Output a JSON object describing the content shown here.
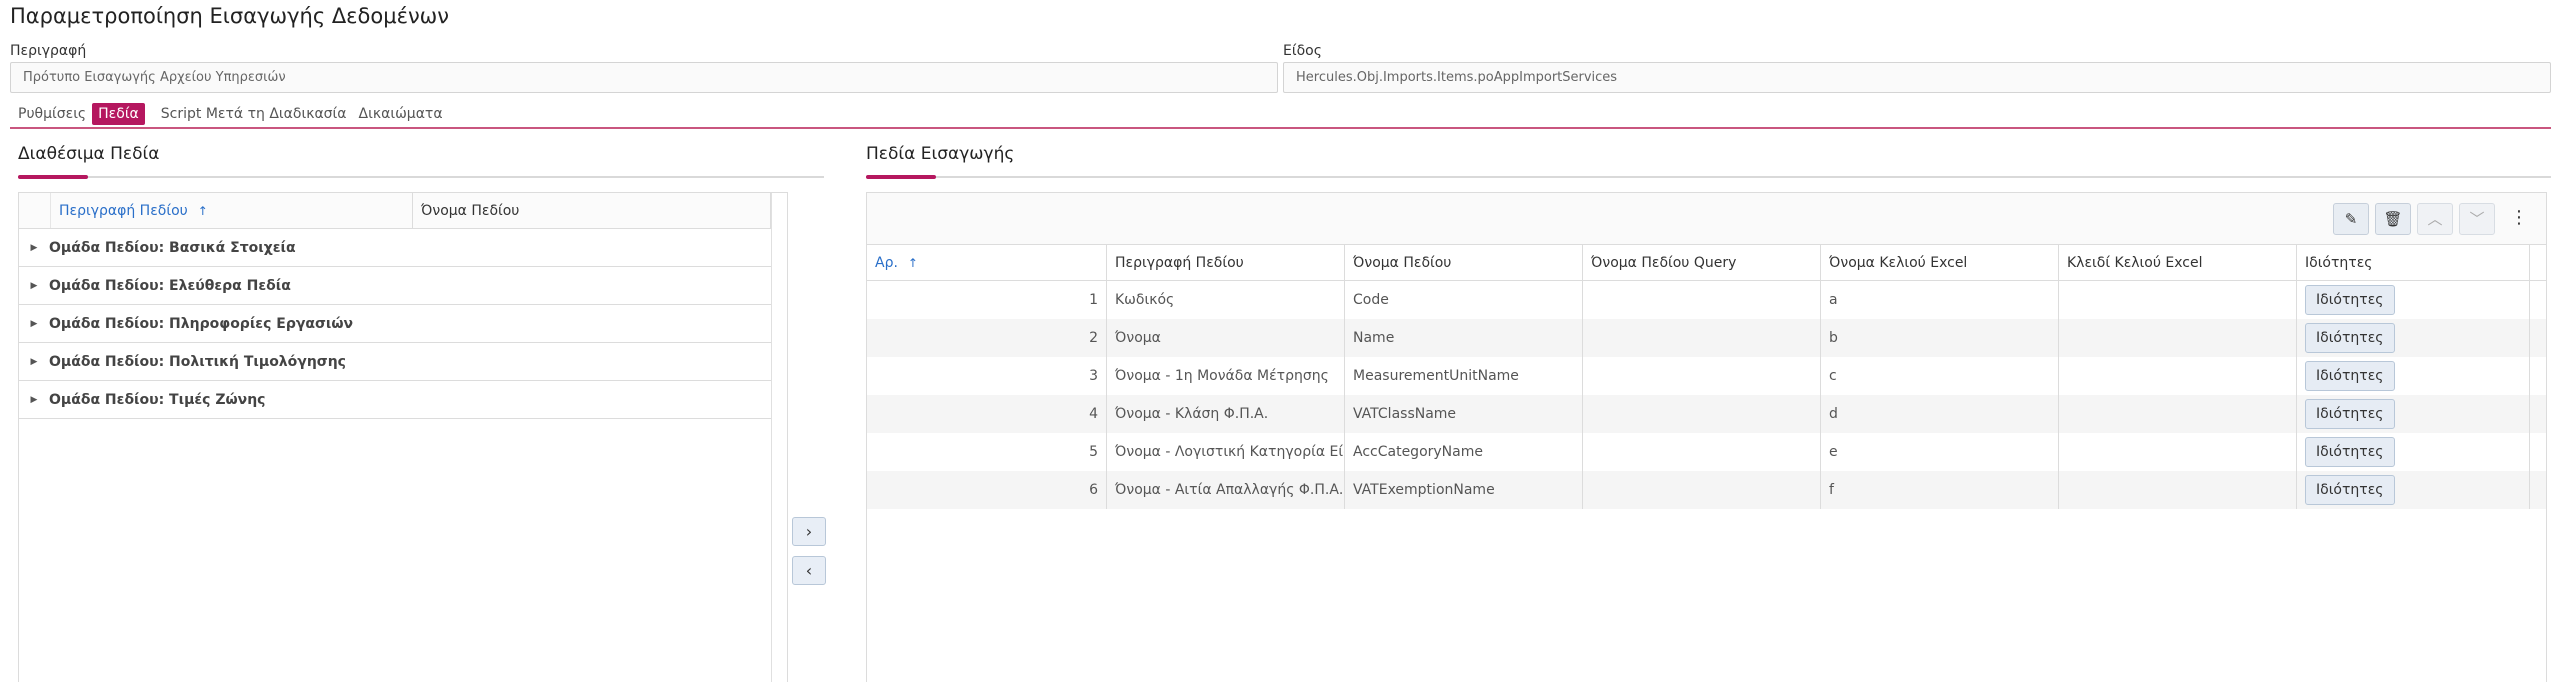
{
  "page": {
    "title": "Παραμετροποίηση Εισαγωγής Δεδομένων"
  },
  "form": {
    "description_label": "Περιγραφή",
    "description_value": "Πρότυπο Εισαγωγής Αρχείου Υπηρεσιών",
    "type_label": "Είδος",
    "type_value": "Hercules.Obj.Imports.Items.poAppImportServices"
  },
  "tabs": [
    {
      "label": "Ρυθμίσεις",
      "active": false
    },
    {
      "label": "Πεδία",
      "active": true
    },
    {
      "label": "Script Μετά τη Διαδικασία",
      "active": false
    },
    {
      "label": "Δικαιώματα",
      "active": false
    }
  ],
  "available": {
    "title": "Διαθέσιμα Πεδία",
    "col_desc": "Περιγραφή Πεδίου",
    "col_name": "Όνομα Πεδίου",
    "sort_icon": "arrow-up-icon",
    "groups": [
      "Ομάδα Πεδίου: Βασικά Στοιχεία",
      "Ομάδα Πεδίου: Ελεύθερα Πεδία",
      "Ομάδα Πεδίου: Πληροφορίες Εργασιών",
      "Ομάδα Πεδίου: Πολιτική Τιμολόγησης",
      "Ομάδα Πεδίου: Τιμές Ζώνης"
    ]
  },
  "move": {
    "right": "›",
    "left": "‹"
  },
  "import": {
    "title": "Πεδία Εισαγωγής",
    "toolbar": {
      "edit": "✎",
      "delete": "🗑",
      "up": "︿",
      "down": "﹀",
      "menu": "⋮"
    },
    "columns": [
      "Αρ.",
      "Περιγραφή Πεδίου",
      "Όνομα Πεδίου",
      "Όνομα Πεδίου Query",
      "Όνομα Κελιού Excel",
      "Κλειδί Κελιού Excel",
      "Ιδιότητες"
    ],
    "button_label": "Ιδιότητες",
    "rows": [
      {
        "num": "1",
        "desc": "Κωδικός",
        "name": "Code",
        "query": "",
        "cell": "a",
        "key": ""
      },
      {
        "num": "2",
        "desc": "Όνομα",
        "name": "Name",
        "query": "",
        "cell": "b",
        "key": ""
      },
      {
        "num": "3",
        "desc": "Όνομα - 1η Μονάδα Μέτρησης",
        "name": "MeasurementUnitName",
        "query": "",
        "cell": "c",
        "key": ""
      },
      {
        "num": "4",
        "desc": "Όνομα - Κλάση Φ.Π.Α.",
        "name": "VATClassName",
        "query": "",
        "cell": "d",
        "key": ""
      },
      {
        "num": "5",
        "desc": "Όνομα - Λογιστική Κατηγορία Είδους",
        "name": "AccCategoryName",
        "query": "",
        "cell": "e",
        "key": ""
      },
      {
        "num": "6",
        "desc": "Όνομα - Αιτία Απαλλαγής Φ.Π.Α.",
        "name": "VATExemptionName",
        "query": "",
        "cell": "f",
        "key": ""
      }
    ]
  }
}
